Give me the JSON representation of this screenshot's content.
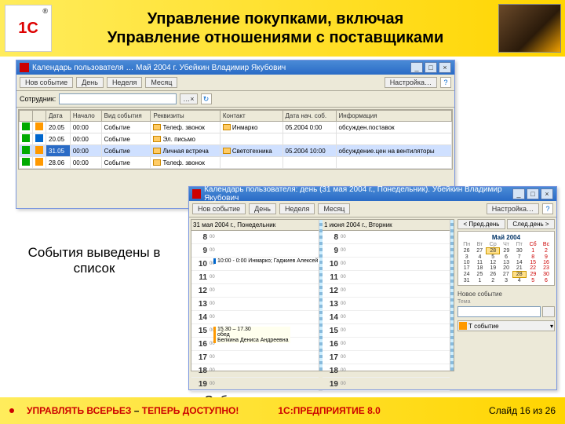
{
  "header": {
    "logo_text": "1С",
    "logo_r": "®",
    "title_line1": "Управление покупками, включая",
    "title_line2": "Управление отношениями с поставщиками"
  },
  "win1": {
    "title": "Календарь пользователя …  Май 2004 г.  Убейкин Владимир Якубович",
    "btn_new": "Нов событие",
    "btn_day": "День",
    "btn_week": "Неделя",
    "btn_month": "Месяц",
    "settings": "Настройка…",
    "sub_label": "Сотрудник:",
    "cols": {
      "c0": "",
      "c1": "",
      "c2": "Дата",
      "c3": "Начало",
      "c4": "Вид события",
      "c5": "Реквизиты",
      "c6": "Контакт",
      "c7": "Дата нач. соб.",
      "c8": "Информация"
    },
    "rows": [
      {
        "date": "20.05",
        "time": "00:00",
        "type": "Событие",
        "req": "Телеф. звонок",
        "contact": "Инмарко",
        "dplan": "05.2004 0:00",
        "info": "обсужден.поставок"
      },
      {
        "date": "20.05",
        "time": "00:00",
        "type": "Событие",
        "req": "Эл. письмо",
        "contact": "",
        "dplan": "",
        "info": ""
      },
      {
        "date": "31.05",
        "time": "00:00",
        "type": "Событие",
        "req": "Личная встреча",
        "contact": "Светотехника",
        "dplan": "05.2004 10:00",
        "info": "обсуждение.цен на вентиляторы"
      },
      {
        "date": "28.06",
        "time": "00:00",
        "type": "Событие",
        "req": "Телеф. звонок",
        "contact": "",
        "dplan": "",
        "info": ""
      }
    ]
  },
  "caption_left": "События выведены в список",
  "win2": {
    "title": "Календарь пользователя: день (31 мая 2004 г., Понедельник). Убейкин Владимир Якубович",
    "btn_new": "Нов событие",
    "btn_day": "День",
    "btn_week": "Неделя",
    "btn_month": "Месяц",
    "settings": "Настройка…",
    "day1": "31 мая 2004 г., Понедельник",
    "day2": "1 июня 2004 г., Вторник",
    "nav_prev": "< Пред.день",
    "nav_next": "След.день >",
    "month_caption": "Май 2004",
    "dow": [
      "Пн",
      "Вт",
      "Ср",
      "Чт",
      "Пт",
      "Сб",
      "Вс"
    ],
    "weeks": [
      [
        "26",
        "27",
        "28",
        "29",
        "30",
        "1",
        "2"
      ],
      [
        "3",
        "4",
        "5",
        "6",
        "7",
        "8",
        "9"
      ],
      [
        "10",
        "11",
        "12",
        "13",
        "14",
        "15",
        "16"
      ],
      [
        "17",
        "18",
        "19",
        "20",
        "21",
        "22",
        "23"
      ],
      [
        "24",
        "25",
        "26",
        "27",
        "28",
        "29",
        "30"
      ],
      [
        "31",
        "1",
        "2",
        "3",
        "4",
        "5",
        "6"
      ]
    ],
    "today_cell": "28",
    "new_event_label": "Новое событие",
    "new_event_tag": "Тема",
    "type_btn": "Т   событие",
    "hours": [
      "8",
      "9",
      "10",
      "11",
      "12",
      "13",
      "14",
      "15",
      "16",
      "17",
      "18",
      "19"
    ],
    "min": "00",
    "evt1": "10:00 - 0:00 Инмарко; Гаджиев  Алексей",
    "evt2a": "15.30 – 17.30",
    "evt2b": "обед",
    "evt2c": "Белкина  Дениса Андреевна"
  },
  "caption_bottom": "События представлены в виде календаря",
  "footer": {
    "left1": "УПРАВЛЯТЬ ВСЕРЬЕЗ",
    "dash": " – ",
    "left2": "ТЕПЕРЬ ДОСТУПНО!",
    "mid": "1С:ПРЕДПРИЯТИЕ 8.0",
    "right": "Слайд 16 из 26"
  }
}
